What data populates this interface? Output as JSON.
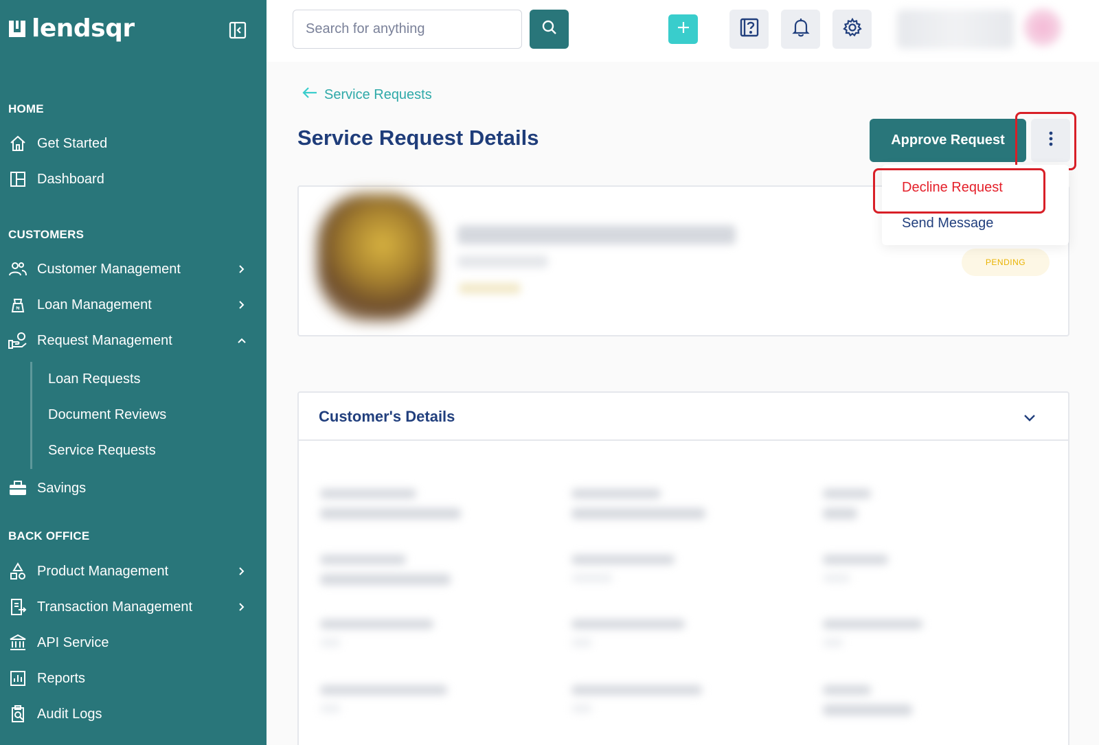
{
  "brand": {
    "name": "lendsqr"
  },
  "topbar": {
    "search_placeholder": "Search for anything"
  },
  "sidebar": {
    "sections": {
      "home": "HOME",
      "customers": "CUSTOMERS",
      "back_office": "BACK OFFICE"
    },
    "items": {
      "get_started": "Get Started",
      "dashboard": "Dashboard",
      "customer_management": "Customer Management",
      "loan_management": "Loan Management",
      "request_management": "Request Management",
      "loan_requests": "Loan Requests",
      "document_reviews": "Document Reviews",
      "service_requests": "Service Requests",
      "savings": "Savings",
      "product_management": "Product Management",
      "transaction_management": "Transaction Management",
      "api_service": "API Service",
      "reports": "Reports",
      "audit_logs": "Audit Logs"
    }
  },
  "main": {
    "back_label": "Service Requests",
    "title": "Service Request Details",
    "approve_label": "Approve Request",
    "menu": {
      "decline": "Decline Request",
      "send_message": "Send Message"
    },
    "status": "PENDING",
    "details_title": "Customer's Details"
  },
  "colors": {
    "sidebar": "#29767a",
    "accent": "#39cdcc",
    "title": "#1f3d7a",
    "decline": "#e4202a",
    "highlight": "#d81f27",
    "pending": "#e9b200"
  }
}
